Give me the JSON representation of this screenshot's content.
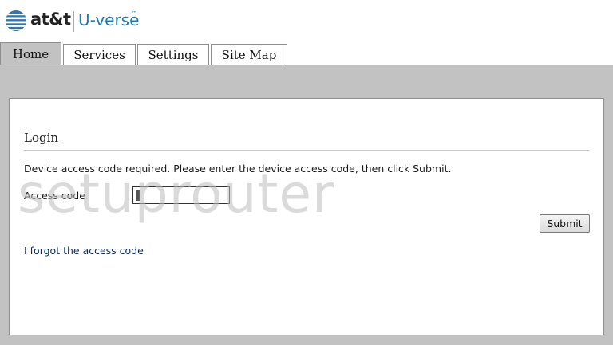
{
  "header": {
    "brand": "at&t",
    "product": "U-verse",
    "trademark": "™",
    "icon": "att-globe-icon"
  },
  "tabs": [
    {
      "label": "Home",
      "active": true
    },
    {
      "label": "Services",
      "active": false
    },
    {
      "label": "Settings",
      "active": false
    },
    {
      "label": "Site Map",
      "active": false
    }
  ],
  "login": {
    "title": "Login",
    "instructions": "Device access code required. Please enter the device access code, then click Submit.",
    "access_code_label": "Access code",
    "access_code_value": "",
    "submit_label": "Submit",
    "forgot_link": "I forgot the access code"
  },
  "watermark": "setuprouter",
  "colors": {
    "frame_gray": "#c2c2c2",
    "brand_blue": "#1a7db5",
    "link_navy": "#0f2a55"
  }
}
